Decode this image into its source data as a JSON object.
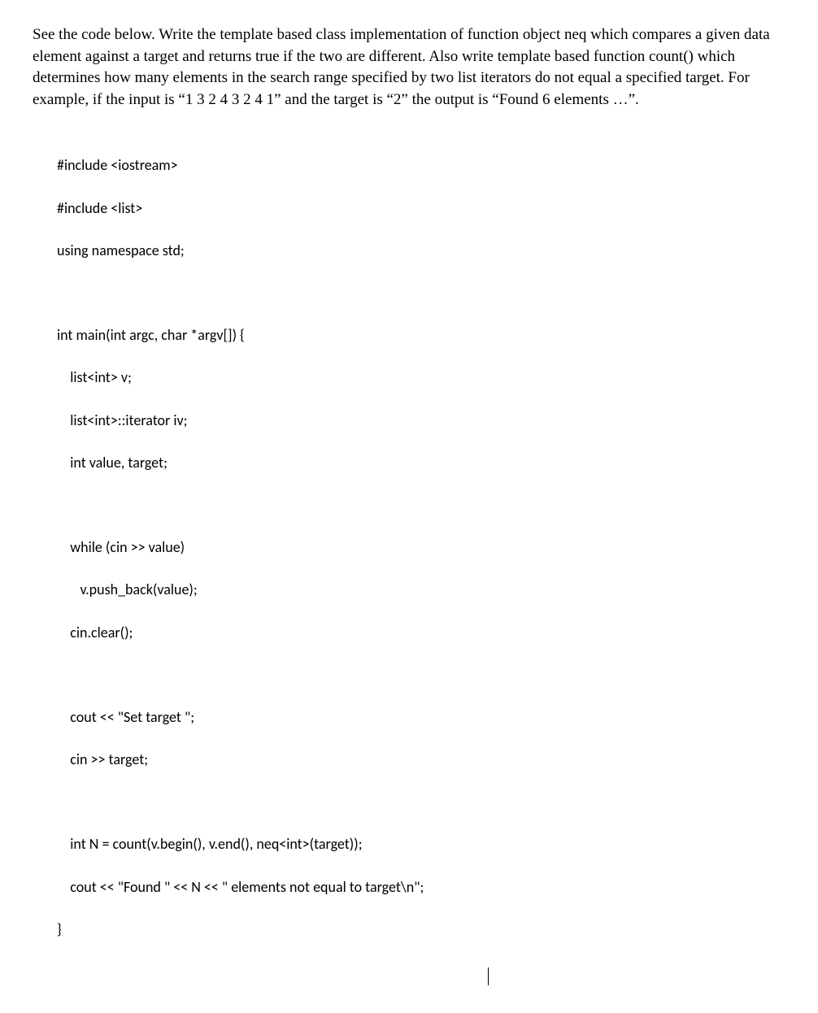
{
  "paragraph": "See the code below. Write the template based class implementation of function object neq which compares a given data element against a target and returns true if the two are different. Also write template based function count() which determines how many elements in the search range specified by two list iterators do not equal a specified target. For example, if the input is “1 3 2 4 3 2 4 1” and the target is “2” the output is “Found 6 elements …”.",
  "code": {
    "line1": "#include <iostream>",
    "line2": "#include <list>",
    "line3": "using namespace std;",
    "line4": "",
    "line5": "int main(int argc, char *argv[]) {",
    "line6": "    list<int> v;",
    "line7": "    list<int>::iterator iv;",
    "line8": "    int value, target;",
    "line9": "",
    "line10": "    while (cin >> value)",
    "line11": "       v.push_back(value);",
    "line12": "    cin.clear();",
    "line13": "",
    "line14": "    cout << \"Set target \";",
    "line15": "    cin >> target;",
    "line16": "",
    "line17": "    int N = count(v.begin(), v.end(), neq<int>(target));",
    "line18": "    cout << \"Found \" << N << \" elements not equal to target\\n\";",
    "line19": "}"
  }
}
